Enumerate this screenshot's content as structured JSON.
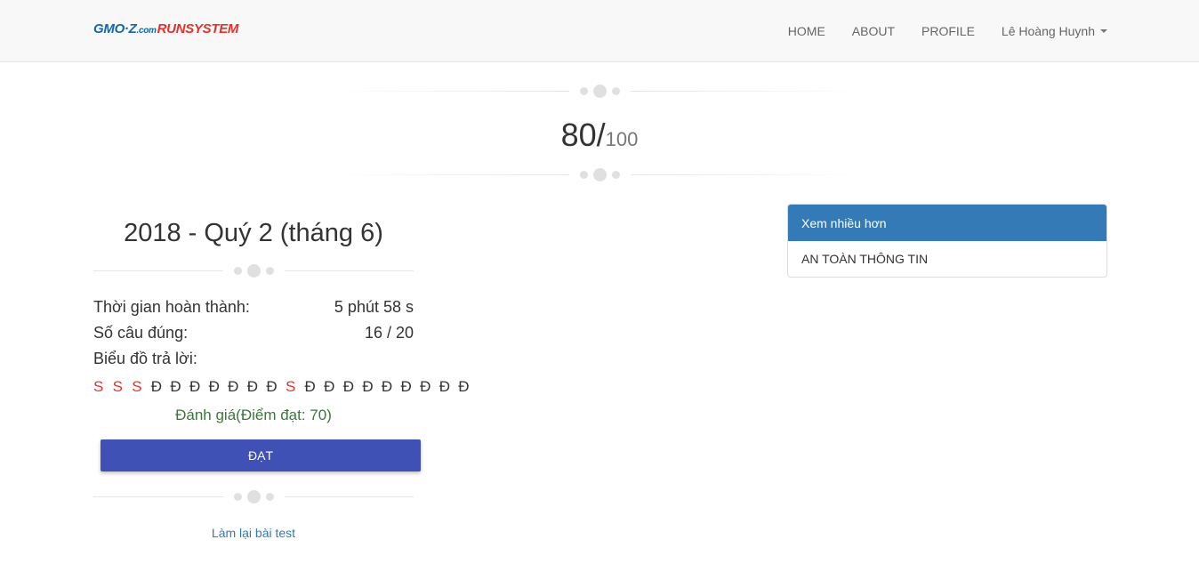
{
  "navbar": {
    "logo": {
      "part1": "GMO·Z",
      "part2": ".com",
      "part3": "RUNSYSTEM"
    },
    "items": [
      {
        "label": "HOME"
      },
      {
        "label": "ABOUT"
      },
      {
        "label": "PROFILE"
      }
    ],
    "user": {
      "label": "Lê Hoàng Huynh"
    }
  },
  "score": {
    "value": "80/",
    "total": "100"
  },
  "exam": {
    "title": "2018 - Quý 2 (tháng 6)",
    "time_label": "Thời gian hoàn thành:",
    "time_value": "5 phút 58 s",
    "correct_label": "Số câu đúng:",
    "correct_value": "16 / 20",
    "chart_label": "Biểu đồ trả lời:",
    "answers": [
      "S",
      "S",
      "S",
      "Đ",
      "Đ",
      "Đ",
      "Đ",
      "Đ",
      "Đ",
      "Đ",
      "S",
      "Đ",
      "Đ",
      "Đ",
      "Đ",
      "Đ",
      "Đ",
      "Đ",
      "Đ",
      "Đ"
    ],
    "evaluation": "Đánh giá(Điểm đạt: 70)",
    "result_button": "ĐẠT",
    "retry_link": "Làm lại bài test"
  },
  "panel": {
    "heading": "Xem nhiều hơn",
    "items": [
      {
        "label": "AN TOÀN THÔNG TIN"
      }
    ]
  },
  "colors": {
    "primary": "#337ab7",
    "button": "#3f51b5",
    "wrong": "#e3342f",
    "evaluation": "#3c763d"
  }
}
